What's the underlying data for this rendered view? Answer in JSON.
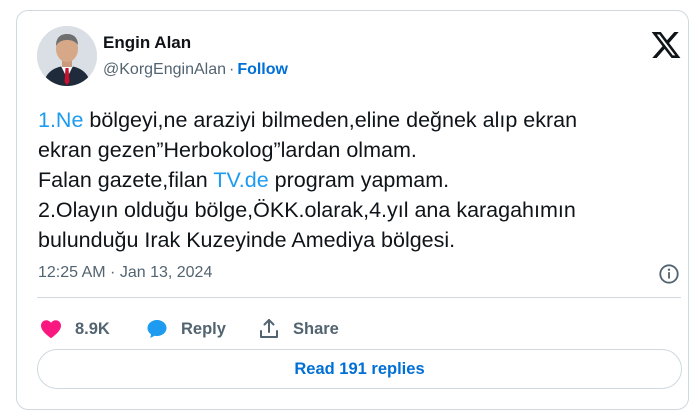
{
  "author": {
    "name": "Engin Alan",
    "handle": "@KorgEnginAlan",
    "separator": "·",
    "follow_label": "Follow"
  },
  "tweet": {
    "line1_link": "1.Ne",
    "line1_rest": " bölgeyi,ne araziyi bilmeden,eline değnek alıp ekran",
    "line2": "ekran gezen”Herbokolog”lardan olmam.",
    "line3_pre": "Falan gazete,filan ",
    "line3_link": "TV.de",
    "line3_post": " program yapmam.",
    "line4": "2.Olayın olduğu bölge,ÖKK.olarak,4.yıl ana karagahımın",
    "line5": "bulunduğu Irak Kuzeyinde Amediya bölgesi."
  },
  "meta": {
    "timestamp": "12:25 AM · Jan 13, 2024"
  },
  "actions": {
    "like_count": "8.9K",
    "reply_label": "Reply",
    "share_label": "Share"
  },
  "footer": {
    "read_replies_label": "Read 191 replies"
  },
  "icons": {
    "logo": "x-logo-icon",
    "info": "info-icon",
    "like": "heart-icon",
    "reply": "speech-bubble-icon",
    "share": "share-upload-icon"
  },
  "colors": {
    "link": "#1d9bf0",
    "follow": "#006fd6",
    "heart": "#f91880",
    "reply_bubble": "#1d9bf0",
    "muted_text": "#536471",
    "border": "#cfd9de"
  }
}
